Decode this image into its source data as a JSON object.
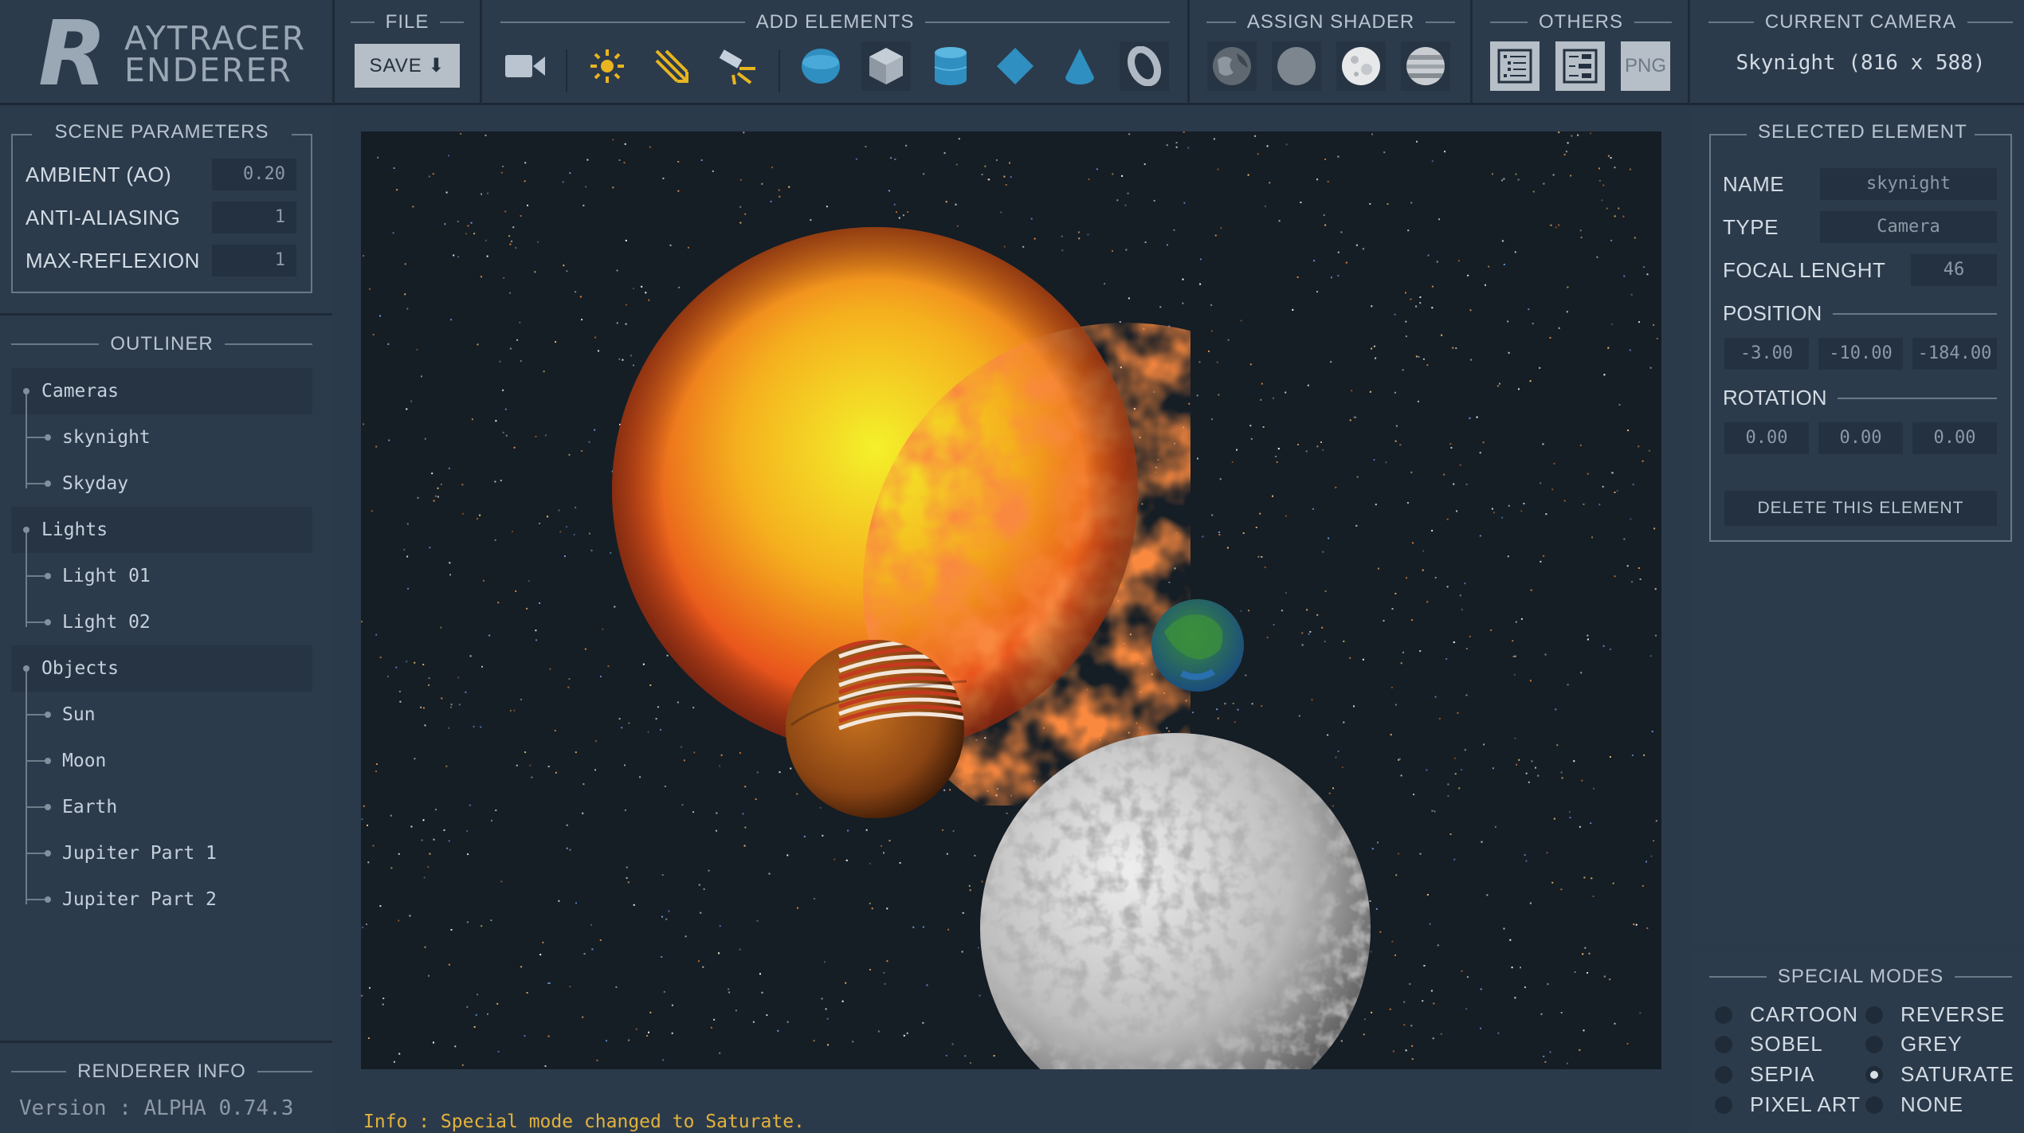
{
  "app": {
    "logo_letter": "R",
    "logo_line1": "AYTRACER",
    "logo_line2": "ENDERER"
  },
  "toolbar": {
    "file_title": "FILE",
    "save_label": "SAVE ⬇",
    "add_title": "ADD ELEMENTS",
    "add_items": [
      "camera-icon",
      "point-light-icon",
      "directional-light-icon",
      "spot-light-icon",
      "sphere-icon",
      "cube-icon",
      "cylinder-icon",
      "diamond-icon",
      "cone-icon",
      "torus-icon"
    ],
    "shader_title": "ASSIGN SHADER",
    "shader_items": [
      "earth-texture-icon",
      "plain-texture-icon",
      "moon-texture-icon",
      "jupiter-texture-icon"
    ],
    "others_title": "OTHERS",
    "png_label": "PNG",
    "camera_title": "CURRENT CAMERA",
    "camera_value": "Skynight (816 x 588)"
  },
  "scene": {
    "title": "SCENE PARAMETERS",
    "params": [
      {
        "label": "AMBIENT (AO)",
        "value": "0.20"
      },
      {
        "label": "ANTI-ALIASING",
        "value": "1"
      },
      {
        "label": "MAX-REFLEXION",
        "value": "1"
      }
    ]
  },
  "outliner": {
    "title": "OUTLINER",
    "groups": [
      {
        "name": "Cameras",
        "items": [
          "skynight",
          "Skyday"
        ]
      },
      {
        "name": "Lights",
        "items": [
          "Light 01",
          "Light 02"
        ]
      },
      {
        "name": "Objects",
        "items": [
          "Sun",
          "Moon",
          "Earth",
          "Jupiter Part 1",
          "Jupiter Part 2"
        ]
      }
    ]
  },
  "renderer": {
    "title": "RENDERER INFO",
    "version": "Version : ALPHA 0.74.3"
  },
  "status": {
    "text": "Info : Special mode changed to Saturate."
  },
  "selected": {
    "title": "SELECTED ELEMENT",
    "name_label": "NAME",
    "name_value": "skynight",
    "type_label": "TYPE",
    "type_value": "Camera",
    "focal_label": "FOCAL LENGHT",
    "focal_value": "46",
    "position_label": "POSITION",
    "position": [
      "-3.00",
      "-10.00",
      "-184.00"
    ],
    "rotation_label": "ROTATION",
    "rotation": [
      "0.00",
      "0.00",
      "0.00"
    ],
    "delete_label": "DELETE THIS ELEMENT"
  },
  "modes": {
    "title": "SPECIAL MODES",
    "items": [
      {
        "label": "CARTOON",
        "selected": false
      },
      {
        "label": "REVERSE",
        "selected": false
      },
      {
        "label": "SOBEL",
        "selected": false
      },
      {
        "label": "GREY",
        "selected": false
      },
      {
        "label": "SEPIA",
        "selected": false
      },
      {
        "label": "SATURATE",
        "selected": true
      },
      {
        "label": "PIXEL ART",
        "selected": false
      },
      {
        "label": "NONE",
        "selected": false
      }
    ]
  },
  "colors": {
    "background": "#2b3a4a",
    "panel": "#2c3b4b",
    "input": "#233140",
    "status_text": "#e3b23c",
    "accent_blue": "#2f8fc0"
  }
}
